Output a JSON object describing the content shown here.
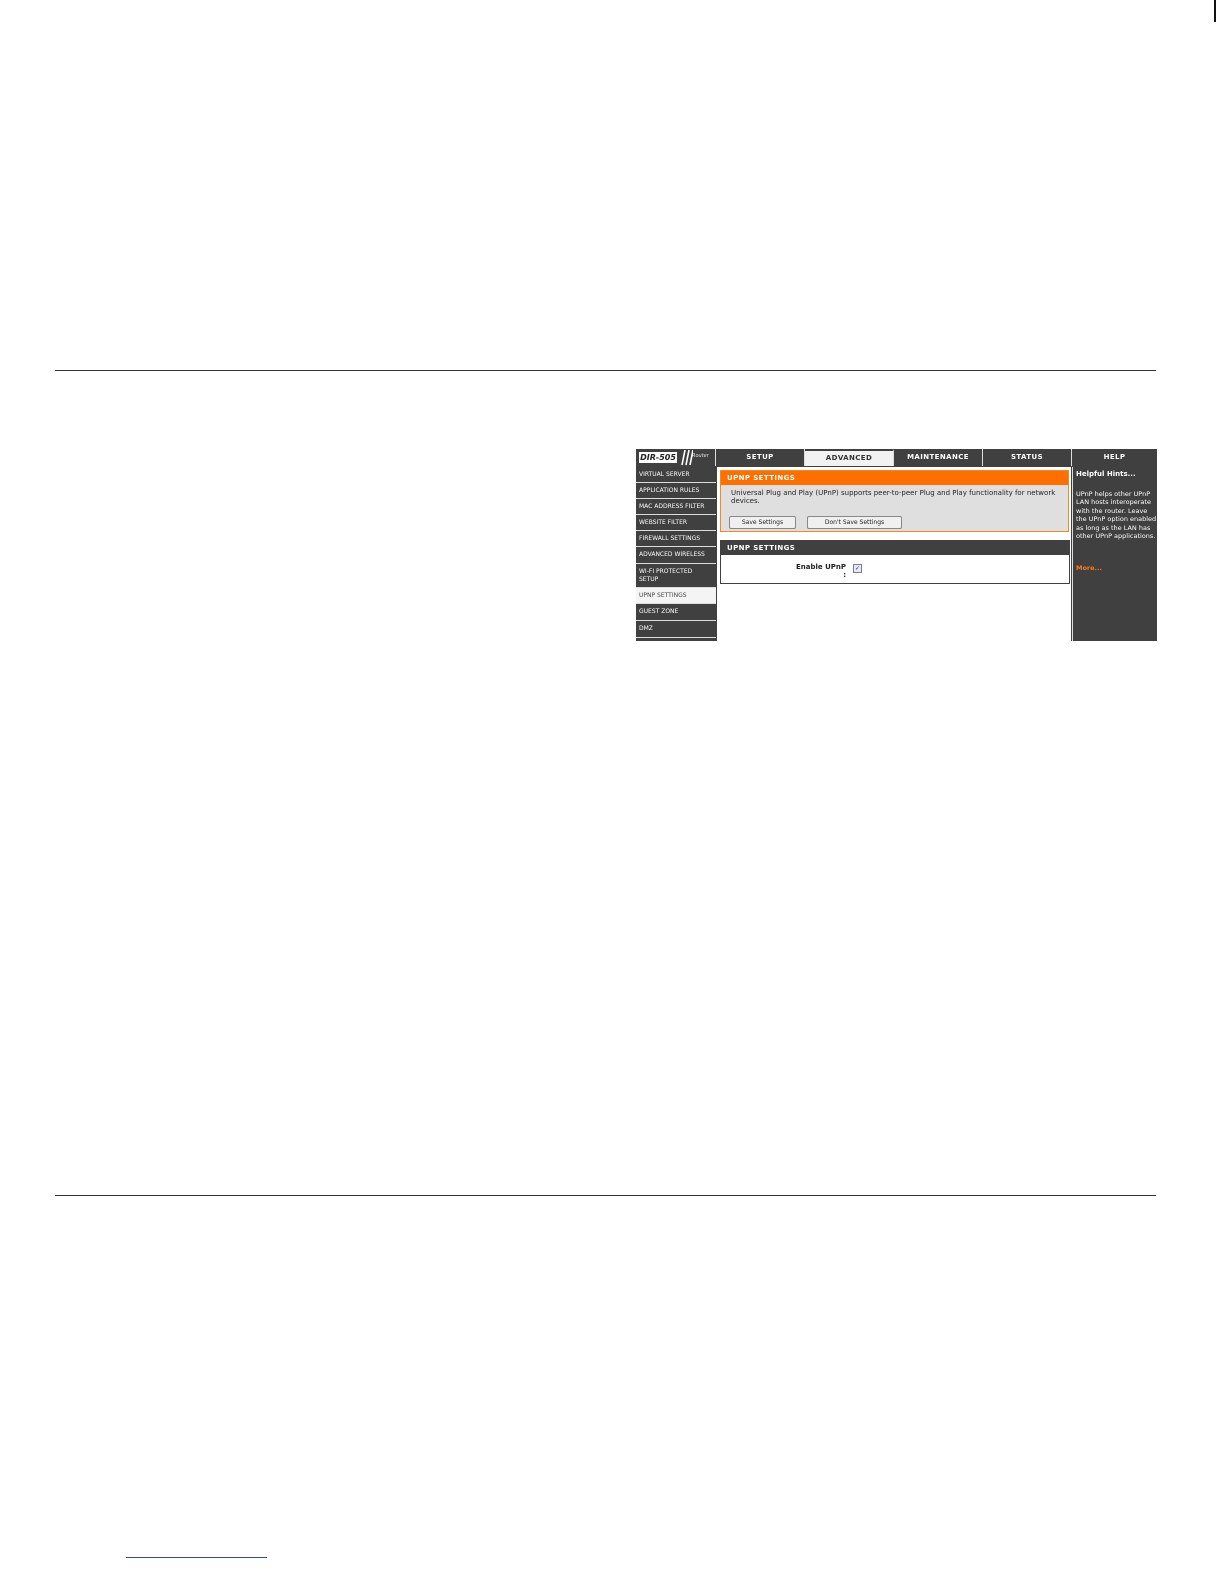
{
  "router": {
    "model": "DIR-505",
    "type": "Router",
    "tabs": [
      {
        "label": "SETUP"
      },
      {
        "label": "ADVANCED"
      },
      {
        "label": "MAINTENANCE"
      },
      {
        "label": "STATUS"
      },
      {
        "label": "HELP"
      }
    ],
    "active_tab": "ADVANCED",
    "sidebar": {
      "items": [
        {
          "label": "VIRTUAL SERVER"
        },
        {
          "label": "APPLICATION RULES"
        },
        {
          "label": "MAC ADDRESS FILTER"
        },
        {
          "label": "WEBSITE FILTER"
        },
        {
          "label": "FIREWALL SETTINGS"
        },
        {
          "label": "ADVANCED WIRELESS"
        },
        {
          "label": "WI-FI PROTECTED SETUP"
        },
        {
          "label": "UPNP SETTINGS"
        },
        {
          "label": "GUEST ZONE"
        },
        {
          "label": "DMZ"
        }
      ],
      "active_item": "UPNP SETTINGS"
    },
    "intro_panel": {
      "title": "UPNP SETTINGS",
      "description": "Universal Plug and Play (UPnP) supports peer-to-peer Plug and Play functionality for network devices.",
      "save_label": "Save Settings",
      "dont_save_label": "Don't Save Settings"
    },
    "settings_panel": {
      "title": "UPNP SETTINGS",
      "enable_label": "Enable UPnP :",
      "enable_checked": true
    },
    "help": {
      "title": "Helpful Hints...",
      "text": "UPnP helps other UPnP LAN hosts interoperate with the router. Leave the UPnP option enabled as long as the LAN has other UPnP applications.",
      "more": "More..."
    },
    "colors": {
      "orange": "#ff6f00",
      "dark": "#404040",
      "link_orange": "#ff7a1a"
    }
  }
}
